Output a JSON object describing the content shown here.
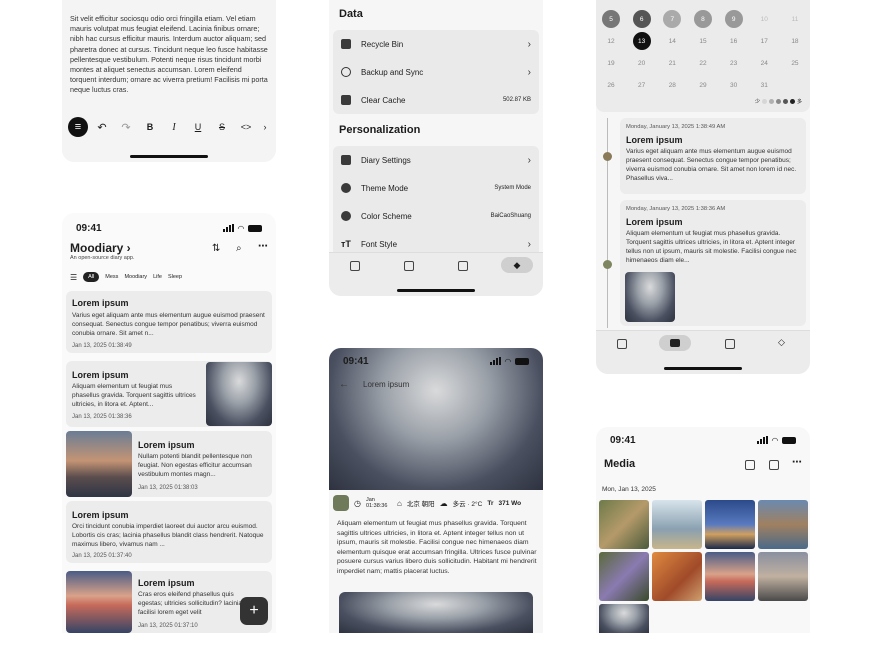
{
  "editor": {
    "text": "Sit velit efficitur sociosqu odio orci fringilla etiam. Vel etiam mauris volutpat mus feugiat eleifend. Lacinia finibus ornare; nibh hac cursus efficitur mauris. Interdum auctor aliquam; sed pharetra donec at cursus. Tincidunt neque leo fusce habitasse pellentesque vestibulum. Potenti neque risus tincidunt morbi montes at aliquet senectus accumsan. Lorem eleifend torquent interdum; ornare ac viverra pretium! Facilisis mi porta neque luctus cras.",
    "toolbar": [
      "≡",
      "↶",
      "↷",
      "B",
      "I",
      "U",
      "S",
      "<>",
      "›"
    ]
  },
  "home": {
    "time": "09:41",
    "title": "Moodiary",
    "subtitle": "An open-source diary app.",
    "filters": [
      "All",
      "Mess",
      "Moodiary",
      "Life",
      "Sleep"
    ],
    "entries": [
      {
        "title": "Lorem ipsum",
        "body": "Varius eget aliquam ante mus elementum augue euismod praesent consequat. Senectus congue tempor penatibus; viverra euismod conubia ornare. Sit amet n...",
        "date": "Jan 13, 2025 01:38:49"
      },
      {
        "title": "Lorem ipsum",
        "body": "Aliquam elementum ut feugiat mus phasellus gravida. Torquent sagittis ultrices ultricies, in litora et. Aptent...",
        "date": "Jan 13, 2025 01:38:36"
      },
      {
        "title": "Lorem ipsum",
        "body": "Nullam potenti blandit pellentesque non feugiat. Non egestas efficitur accumsan vestibulum montes magn...",
        "date": "Jan 13, 2025 01:38:03"
      },
      {
        "title": "Lorem ipsum",
        "body": "Orci tincidunt conubia imperdiet laoreet dui auctor arcu euismod. Lobortis cis cras; lacinia phasellus blandit class hendrerit. Natoque maximus libero, vivamus nam ...",
        "date": "Jan 13, 2025 01:37:40"
      },
      {
        "title": "Lorem ipsum",
        "body": "Cras eros eleifend phasellus quis egestas; ultricies sollicitudin? lacinia; facilisi lorem eget velit",
        "date": "Jan 13, 2025 01:37:10"
      }
    ],
    "fab": "+"
  },
  "settings": {
    "data_header": "Data",
    "personalization_header": "Personalization",
    "rows_data": [
      {
        "label": "Recycle Bin",
        "value": "›"
      },
      {
        "label": "Backup and Sync",
        "value": "›"
      },
      {
        "label": "Clear Cache",
        "value": "502.87 KB"
      }
    ],
    "rows_personal": [
      {
        "label": "Diary Settings",
        "value": "›"
      },
      {
        "label": "Theme Mode",
        "value": "System Mode"
      },
      {
        "label": "Color Scheme",
        "value": "BaiCaoShuang"
      },
      {
        "label": "Font Style",
        "value": "›"
      }
    ]
  },
  "detail": {
    "time": "09:41",
    "back_title": "Lorem ipsum",
    "meta_date": "Jan 01:38:36",
    "meta_location": "北京 朝阳",
    "meta_weather": "多云 · 2°C",
    "meta_words": "371 Wo",
    "body": "Aliquam elementum ut feugiat mus phasellus gravida. Torquent sagittis ultrices ultricies, in litora et. Aptent integer tellus non ut ipsum, mauris sit molestie. Facilisi congue nec himenaeos diam elementum quisque erat accumsan fringilla. Ultrices fusce pulvinar posuere cursus varius libero duis sollicitudin. Habitant mi hendrerit imperdiet nam; mattis placerat luctus."
  },
  "calendar": {
    "row1": [
      "5",
      "6",
      "7",
      "8",
      "9",
      "10",
      "11"
    ],
    "row2": [
      "12",
      "13",
      "14",
      "15",
      "16",
      "17",
      "18"
    ],
    "row3": [
      "19",
      "20",
      "21",
      "22",
      "23",
      "24",
      "25"
    ],
    "row4": [
      "26",
      "27",
      "28",
      "29",
      "30",
      "31",
      ""
    ],
    "legend_less": "少",
    "legend_more": "多",
    "timeline": [
      {
        "date": "Monday, January 13, 2025 1:38:49 AM",
        "title": "Lorem ipsum",
        "body": "Varius eget aliquam ante mus elementum augue euismod praesent consequat. Senectus congue tempor penatibus; viverra euismod conubia ornare. Sit amet non lorem id nec. Phasellus viva..."
      },
      {
        "date": "Monday, January 13, 2025 1:38:36 AM",
        "title": "Lorem ipsum",
        "body": "Aliquam elementum ut feugiat mus phasellus gravida. Torquent sagittis ultrices ultricies, in litora et. Aptent integer tellus non ut ipsum, mauris sit molestie. Facilisi congue nec himenaeos diam ele..."
      }
    ]
  },
  "media": {
    "time": "09:41",
    "title": "Media",
    "date": "Mon, Jan 13, 2025"
  }
}
